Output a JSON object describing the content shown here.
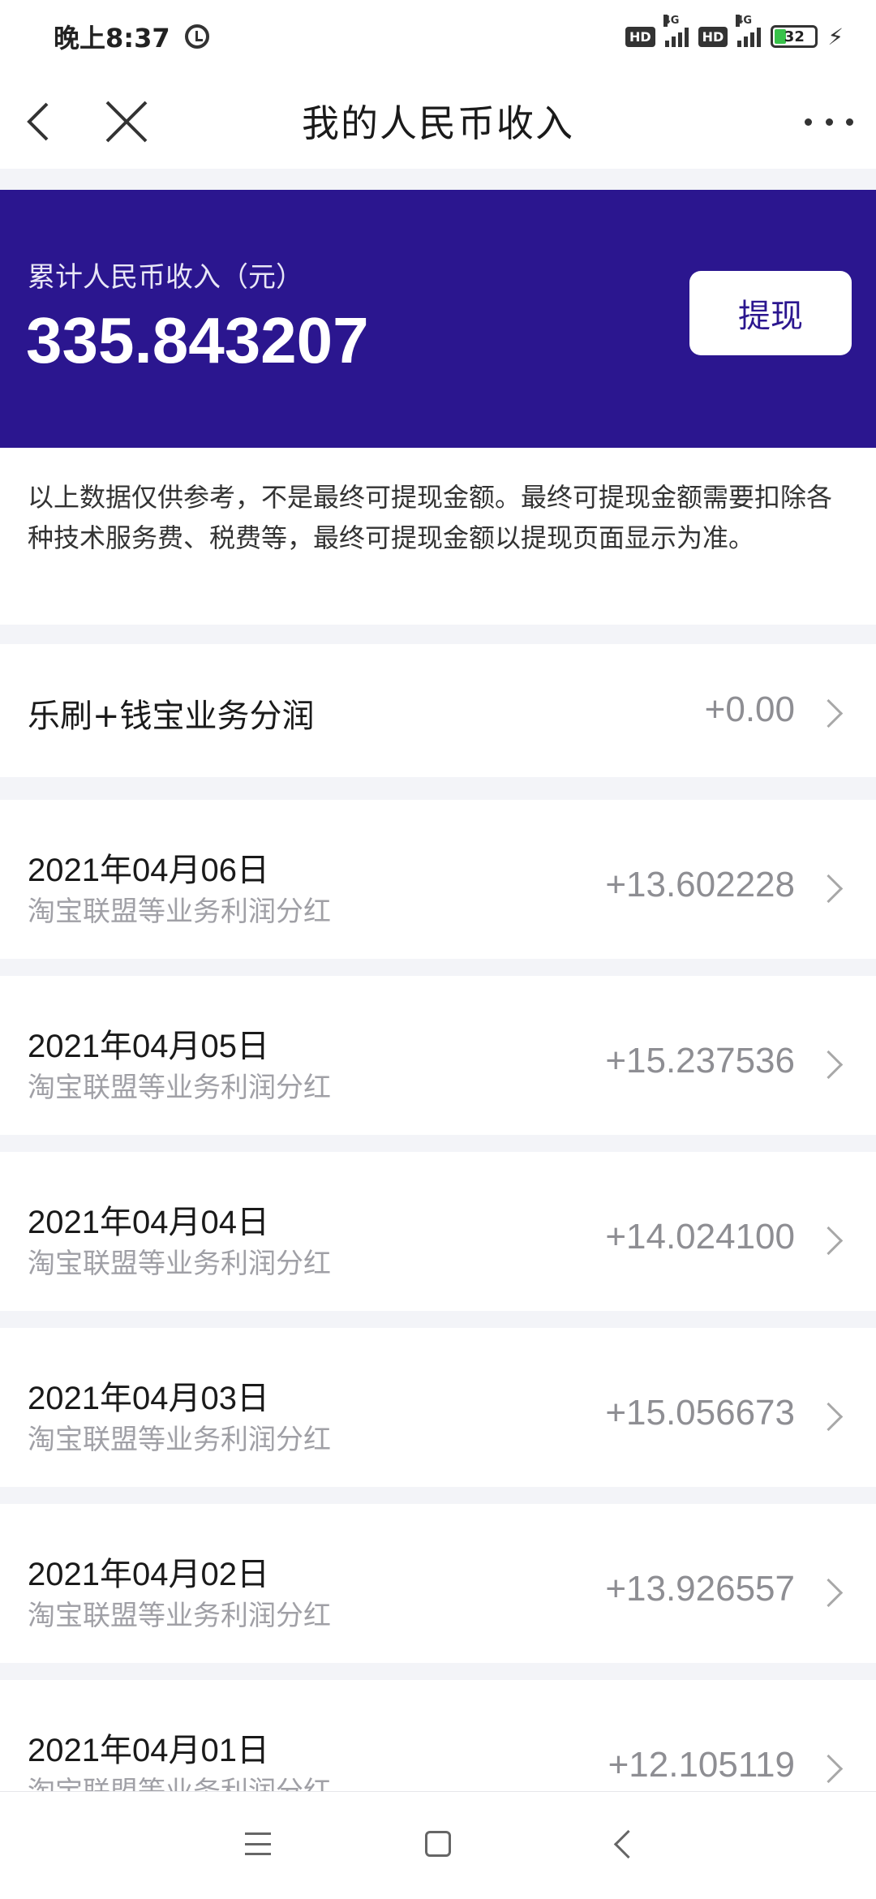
{
  "status_bar": {
    "time": "晚上8:37",
    "hd_label": "HD",
    "network": "4G",
    "battery": "32"
  },
  "header": {
    "title": "我的人民币收入"
  },
  "banner": {
    "label": "累计人民币收入（元）",
    "amount": "335.843207",
    "withdraw_label": "提现",
    "background_color": "#2b168f"
  },
  "notice": {
    "text": "以上数据仅供参考，不是最终可提现金额。最终可提现金额需要扣除各种技术服务费、税费等，最终可提现金额以提现页面显示为准。"
  },
  "summary": {
    "title": "乐刷+钱宝业务分润",
    "amount": "+0.00"
  },
  "records": [
    {
      "date": "2021年04月06日",
      "desc": "淘宝联盟等业务利润分红",
      "amount": "+13.602228"
    },
    {
      "date": "2021年04月05日",
      "desc": "淘宝联盟等业务利润分红",
      "amount": "+15.237536"
    },
    {
      "date": "2021年04月04日",
      "desc": "淘宝联盟等业务利润分红",
      "amount": "+14.024100"
    },
    {
      "date": "2021年04月03日",
      "desc": "淘宝联盟等业务利润分红",
      "amount": "+15.056673"
    },
    {
      "date": "2021年04月02日",
      "desc": "淘宝联盟等业务利润分红",
      "amount": "+13.926557"
    },
    {
      "date": "2021年04月01日",
      "desc": "淘宝联盟等业务利润分红",
      "amount": "+12.105119"
    }
  ],
  "icons": {
    "back": "back-arrow-icon",
    "close": "close-icon",
    "more": "more-dots-icon",
    "chevron": "chevron-right-icon"
  }
}
